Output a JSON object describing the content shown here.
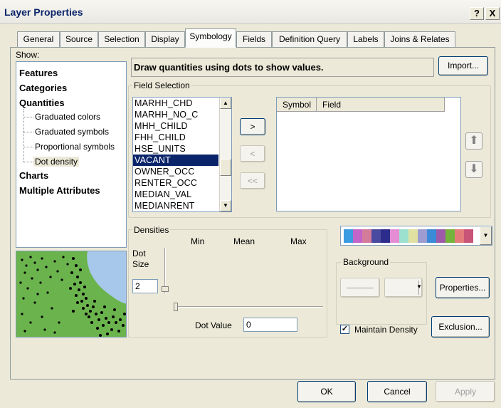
{
  "window": {
    "title": "Layer Properties",
    "help_glyph": "?",
    "close_glyph": "X"
  },
  "tabs": [
    {
      "label": "General",
      "active": false
    },
    {
      "label": "Source",
      "active": false
    },
    {
      "label": "Selection",
      "active": false
    },
    {
      "label": "Display",
      "active": false
    },
    {
      "label": "Symbology",
      "active": true
    },
    {
      "label": "Fields",
      "active": false
    },
    {
      "label": "Definition Query",
      "active": false
    },
    {
      "label": "Labels",
      "active": false
    },
    {
      "label": "Joins & Relates",
      "active": false
    }
  ],
  "show": {
    "label": "Show:",
    "tree": {
      "features": "Features",
      "categories": "Categories",
      "quantities": "Quantities",
      "graduated_colors": "Graduated colors",
      "graduated_symbols": "Graduated symbols",
      "proportional_symbols": "Proportional symbols",
      "dot_density": "Dot density",
      "charts": "Charts",
      "multiple_attributes": "Multiple Attributes",
      "selected": "Dot density"
    }
  },
  "description": "Draw quantities using dots to show values.",
  "import_button": "Import...",
  "field_selection": {
    "title": "Field Selection",
    "fields": [
      "MARHH_CHD",
      "MARHH_NO_C",
      "MHH_CHILD",
      "FHH_CHILD",
      "HSE_UNITS",
      "VACANT",
      "OWNER_OCC",
      "RENTER_OCC",
      "MEDIAN_VAL",
      "MEDIANRENT"
    ],
    "selected_field": "VACANT",
    "add_button": ">",
    "remove_button": "<",
    "remove_all_button": "<<",
    "columns": {
      "symbol": "Symbol",
      "field": "Field"
    }
  },
  "densities": {
    "title": "Densities",
    "min_label": "Min",
    "mean_label": "Mean",
    "max_label": "Max",
    "dot_size_label": "Dot Size",
    "dot_size_value": "2",
    "dot_value_label": "Dot Value",
    "dot_value": "0"
  },
  "color_ramp": [
    "#3a9be0",
    "#c264c8",
    "#d47a9a",
    "#4a4aa0",
    "#2c2c8c",
    "#e48cd4",
    "#9ce0d0",
    "#e0e0a0",
    "#9c9cd0",
    "#3a8ad8",
    "#9c5aa8",
    "#74b43c",
    "#e47c7c",
    "#c85478"
  ],
  "background": {
    "title": "Background"
  },
  "properties_button": "Properties...",
  "maintain_density": {
    "label": "Maintain Density",
    "checked": true
  },
  "exclusion_button": "Exclusion...",
  "footer": {
    "ok": "OK",
    "cancel": "Cancel",
    "apply": "Apply"
  },
  "colors": {
    "selection": "#0a246a",
    "dialog_bg": "#ece9d8",
    "preview_land": "#6bb34d",
    "preview_water": "#a7c8ea"
  }
}
